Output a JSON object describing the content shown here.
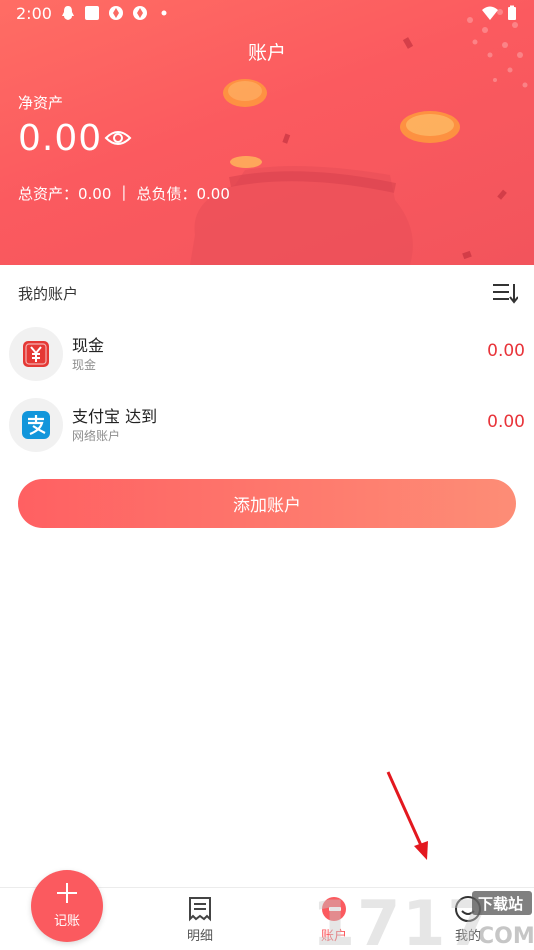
{
  "status_bar": {
    "time": "2:00",
    "icons_left": [
      "qq-icon",
      "square-icon",
      "pinwheel-icon",
      "pinwheel-icon",
      "dot-icon"
    ],
    "icons_right": [
      "wifi-icon",
      "battery-icon"
    ]
  },
  "header": {
    "title": "账户",
    "net_assets_label": "净资产",
    "net_assets_value": "0.00",
    "total_assets_text": "总资产：0.00",
    "separator": "|",
    "total_liabilities_text": "总负债：0.00",
    "eye_icon": "eye-icon"
  },
  "accounts_section": {
    "title": "我的账户",
    "sort_icon": "sort-list-icon",
    "items": [
      {
        "name": "现金",
        "sub": "现金",
        "amount": "0.00",
        "icon": "cash-yuan-icon",
        "icon_color": "#e53935"
      },
      {
        "name": "支付宝 达到",
        "sub": "网络账户",
        "amount": "0.00",
        "icon": "alipay-icon",
        "icon_color": "#1296db"
      }
    ],
    "add_button": "添加账户"
  },
  "bottom_nav": {
    "fab_label": "记账",
    "items": [
      {
        "label": "明细",
        "icon": "receipt-icon",
        "active": false
      },
      {
        "label": "账户",
        "icon": "wallet-icon",
        "active": true
      },
      {
        "label": "我的",
        "icon": "profile-icon",
        "active": false
      }
    ]
  },
  "watermark": {
    "text": "1717",
    "site": "下载站",
    "suffix": "COM"
  },
  "colors": {
    "primary": "#fb5a5f",
    "amount_red": "#e8343a",
    "button_gradient_start": "#ff6062",
    "button_gradient_end": "#fd8d76"
  }
}
